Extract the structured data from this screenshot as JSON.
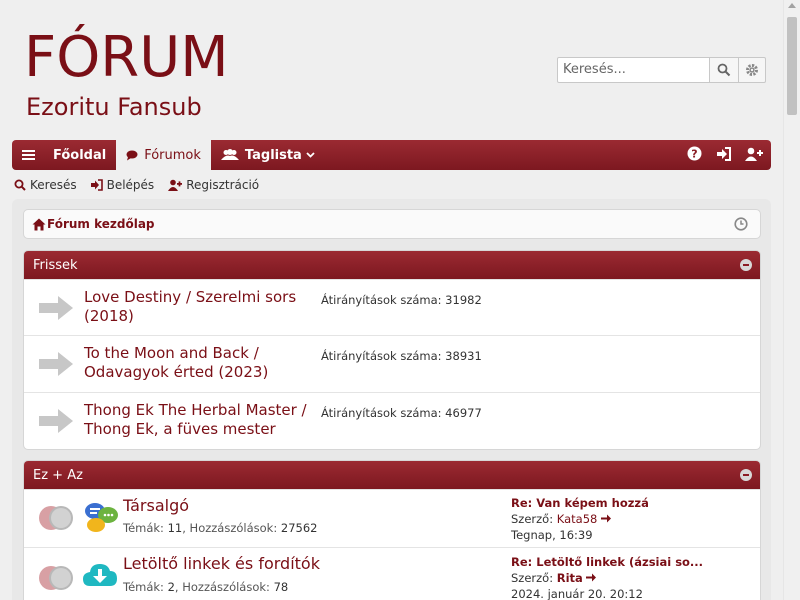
{
  "header": {
    "logo_title": "FÓRUM",
    "logo_subtitle": "Ezoritu Fansub",
    "search_placeholder": "Keresés..."
  },
  "nav": {
    "home": "Főoldal",
    "forums": "Fórumok",
    "members": "Taglista"
  },
  "subnav": {
    "search": "Keresés",
    "login": "Belépés",
    "register": "Regisztráció"
  },
  "breadcrumb": {
    "label": "Fórum kezdőlap"
  },
  "categories": [
    {
      "title": "Frissek",
      "rows": [
        {
          "title_l1": "Love Destiny / Szerelmi sors",
          "title_l2": "(2018)",
          "redirect": "Átirányítások száma: 31982"
        },
        {
          "title_l1": "To the Moon and Back /",
          "title_l2": "Odavagyok érted (2023)",
          "redirect": "Átirányítások száma: 38931"
        },
        {
          "title_l1": "Thong Ek The Herbal Master /",
          "title_l2": "Thong Ek, a füves mester",
          "redirect": "Átirányítások száma: 46977"
        }
      ]
    },
    {
      "title": "Ez + Az",
      "forums": [
        {
          "title": "Társalgó",
          "topics_label": "Témák:",
          "topics": "11",
          "posts_label": "Hozzászólások:",
          "posts": "27562",
          "last_title": "Re: Van képem hozzá",
          "by_label": "Szerző:",
          "author": "Kata58",
          "time": "Tegnap, 16:39"
        },
        {
          "title": "Letöltő linkek és fordítók",
          "topics_label": "Témák:",
          "topics": "2",
          "posts_label": "Hozzászólások:",
          "posts": "78",
          "last_title": "Re: Letöltő linkek (ázsiai so...",
          "by_label": "Szerző:",
          "author": "Rita",
          "time": "2024. január 20. 20:12"
        }
      ]
    }
  ],
  "colors": {
    "brand": "#7a0f16",
    "nav_top": "#9b2a32",
    "nav_bottom": "#7d1820"
  }
}
